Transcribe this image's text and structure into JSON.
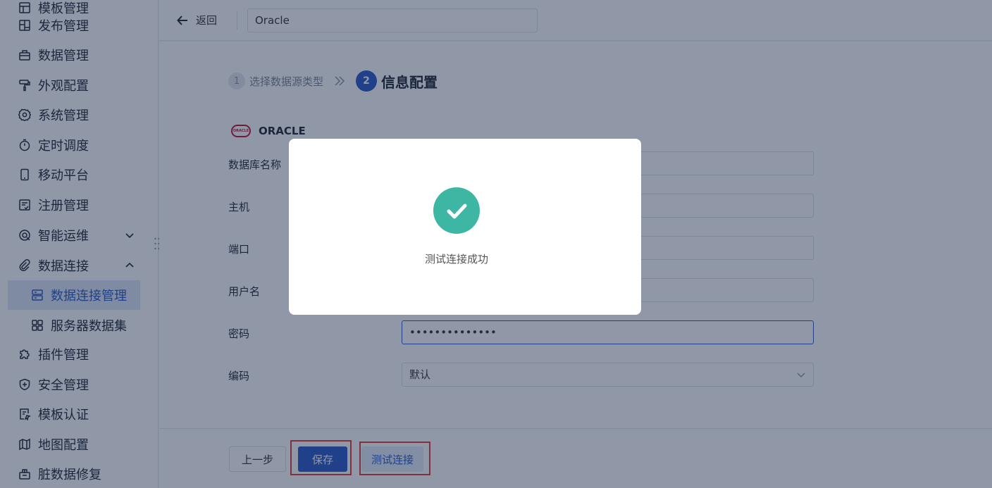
{
  "sidebar": {
    "items": [
      {
        "label": "模板管理",
        "icon": "template-icon"
      },
      {
        "label": "发布管理",
        "icon": "publish-icon"
      },
      {
        "label": "数据管理",
        "icon": "data-manage-icon"
      },
      {
        "label": "外观配置",
        "icon": "paint-roller-icon"
      },
      {
        "label": "系统管理",
        "icon": "gear-icon"
      },
      {
        "label": "定时调度",
        "icon": "timer-icon"
      },
      {
        "label": "移动平台",
        "icon": "mobile-icon"
      },
      {
        "label": "注册管理",
        "icon": "register-icon"
      },
      {
        "label": "智能运维",
        "icon": "ops-icon"
      },
      {
        "label": "数据连接",
        "icon": "link-icon"
      },
      {
        "label": "数据连接管理",
        "icon": "db-connection-icon"
      },
      {
        "label": "服务器数据集",
        "icon": "server-dataset-icon"
      },
      {
        "label": "插件管理",
        "icon": "puzzle-icon"
      },
      {
        "label": "安全管理",
        "icon": "shield-icon"
      },
      {
        "label": "模板认证",
        "icon": "cert-icon"
      },
      {
        "label": "地图配置",
        "icon": "map-icon"
      },
      {
        "label": "脏数据修复",
        "icon": "repair-icon"
      }
    ]
  },
  "topbar": {
    "back_label": "返回",
    "connection_name": "Oracle"
  },
  "steps": {
    "step1_num": "1",
    "step1_label": "选择数据源类型",
    "step2_num": "2",
    "step2_label": "信息配置"
  },
  "db": {
    "name": "ORACLE",
    "logo_text": "ORACLE"
  },
  "form": {
    "db_name_label": "数据库名称",
    "host_label": "主机",
    "port_label": "端口",
    "user_label": "用户名",
    "password_label": "密码",
    "password_value": "••••••••••••••",
    "encoding_label": "编码",
    "encoding_value": "默认"
  },
  "footer": {
    "prev_label": "上一步",
    "save_label": "保存",
    "test_label": "测试连接"
  },
  "modal": {
    "message": "测试连接成功"
  },
  "colors": {
    "primary": "#2b57c8",
    "success": "#3db6a4",
    "highlight": "#e03b3b",
    "oracle_red": "#c8102e"
  }
}
